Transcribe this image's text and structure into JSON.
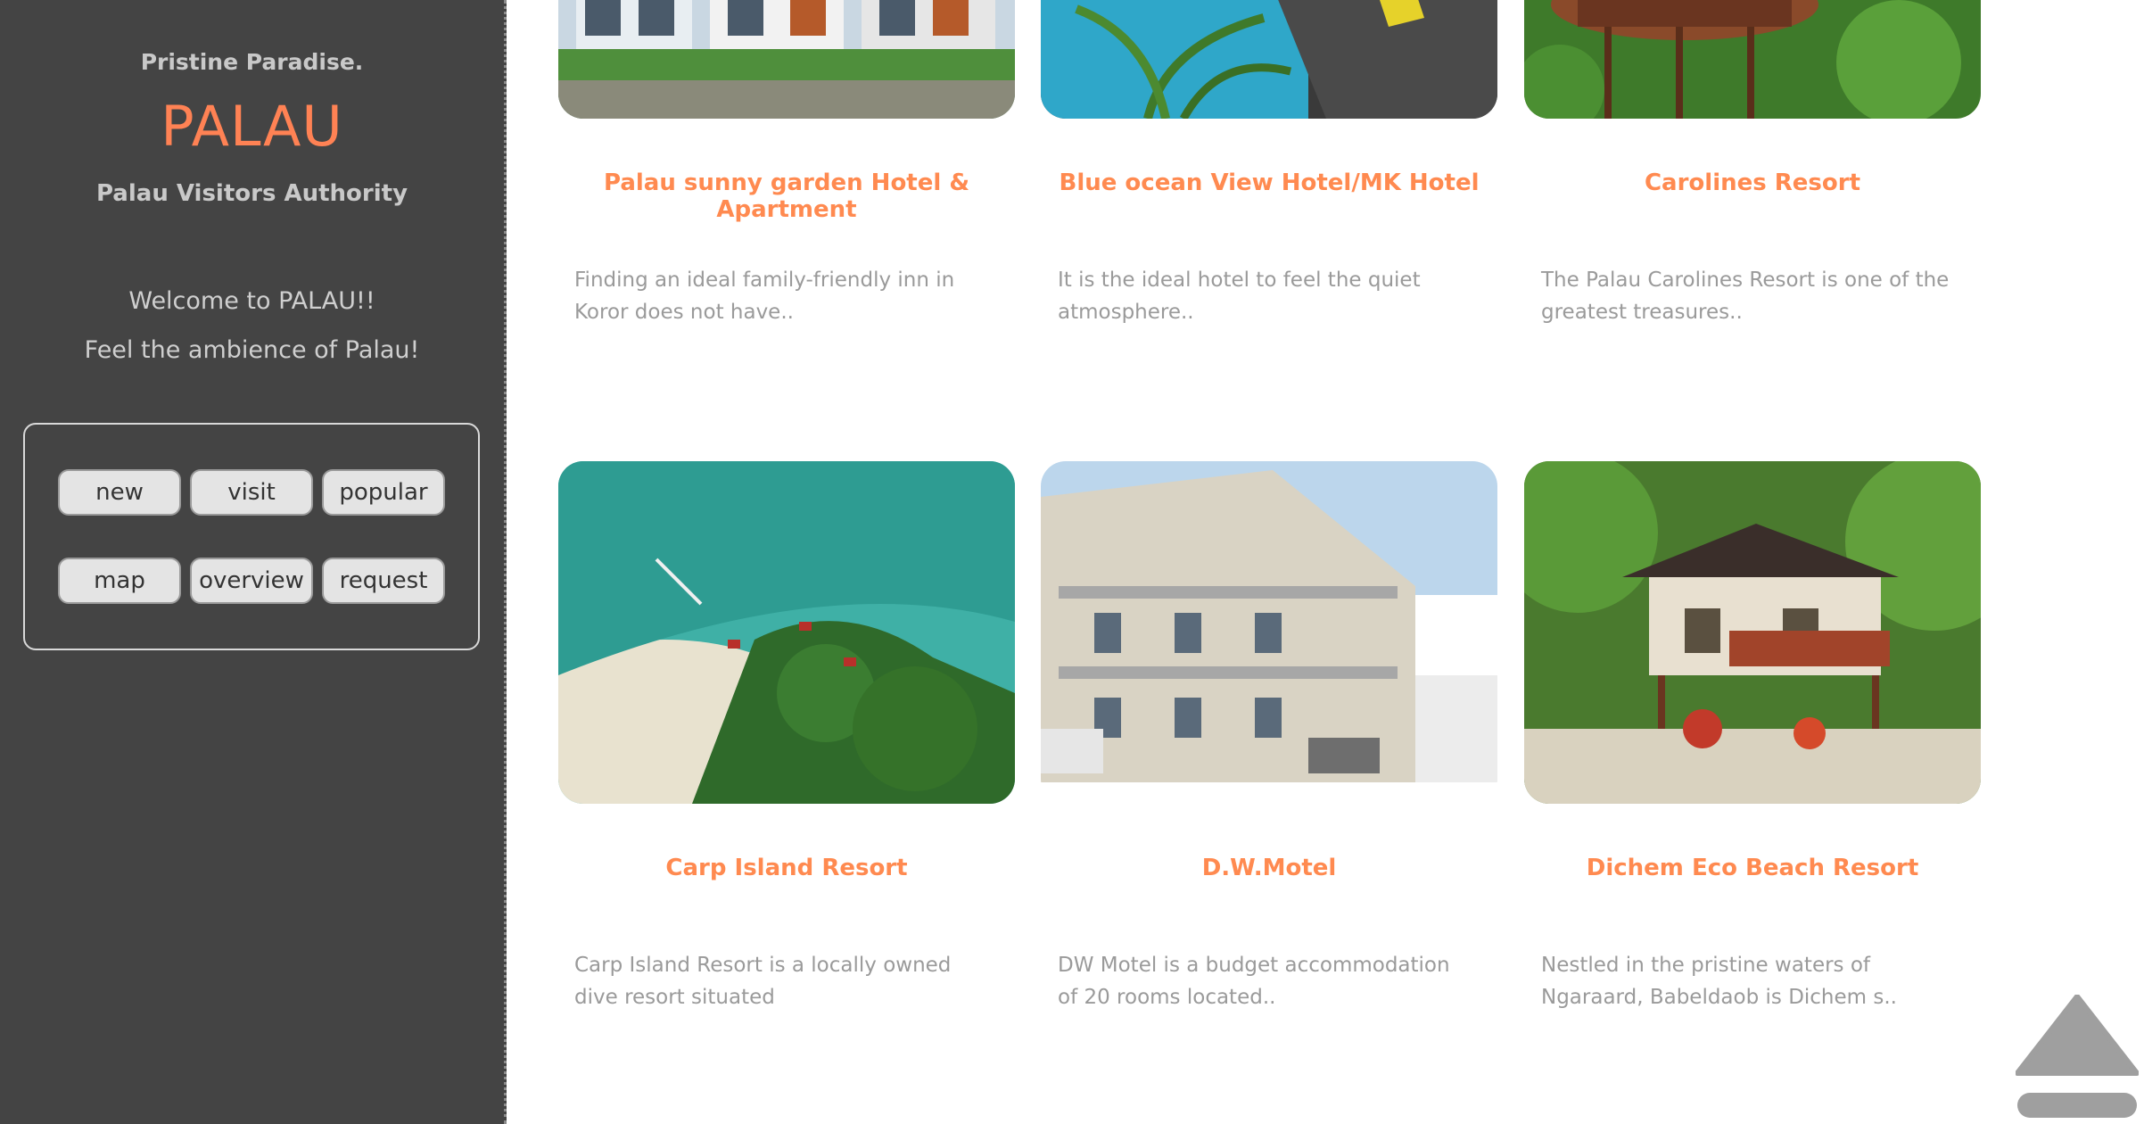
{
  "sidebar": {
    "tagline": "Pristine Paradise.",
    "site_title": "PALAU",
    "authority": "Palau Visitors Authority",
    "welcome": "Welcome to PALAU!!",
    "ambience": "Feel the ambience of Palau!",
    "menu": {
      "new": "new",
      "visit": "visit",
      "popular": "popular",
      "map": "map",
      "overview": "overview",
      "request": "request"
    }
  },
  "cards": {
    "c1": {
      "title": "Palau sunny garden Hotel & Apartment",
      "desc": "Finding an ideal family-friendly inn in Koror does not have.."
    },
    "c2": {
      "title": "Blue ocean View Hotel/MK Hotel",
      "desc": "It is the ideal hotel to feel the quiet atmosphere.."
    },
    "c3": {
      "title": "Carolines Resort",
      "desc": "The Palau Carolines Resort is one of the greatest treasures.."
    },
    "c4": {
      "title": "Carp Island Resort",
      "desc": "Carp Island Resort is a locally owned dive resort situated"
    },
    "c5": {
      "title": "D.W.Motel",
      "desc": "DW Motel is a budget accommodation of 20 rooms located.."
    },
    "c6": {
      "title": "Dichem Eco Beach Resort",
      "desc": "Nestled in the pristine waters of Ngaraard, Babeldaob is Dichem   s.."
    }
  },
  "icons": {
    "scroll_top": "scroll-to-top-icon"
  },
  "colors": {
    "accent": "#ff8254",
    "sidebar_bg": "#444444",
    "desc_text": "#9a9a9a"
  }
}
